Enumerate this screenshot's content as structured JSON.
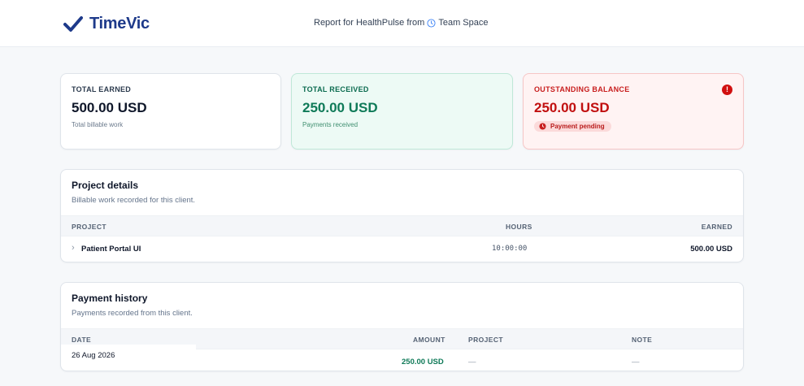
{
  "header": {
    "logo_text": "TimeVic",
    "report_prefix": "Report for HealthPulse from",
    "report_space": "Team Space",
    "brand_color": "#1e3a8a"
  },
  "summary": {
    "earned": {
      "label": "TOTAL EARNED",
      "value": "500.00 USD",
      "sub": "Total billable work"
    },
    "received": {
      "label": "TOTAL RECEIVED",
      "value": "250.00 USD",
      "sub": "Payments received"
    },
    "outstanding": {
      "label": "OUTSTANDING BALANCE",
      "value": "250.00 USD",
      "badge": "Payment pending",
      "alert_icon": "!"
    }
  },
  "projects": {
    "title": "Project details",
    "subtitle": "Billable work recorded for this client.",
    "columns": {
      "project": "PROJECT",
      "hours": "HOURS",
      "earned": "EARNED"
    },
    "rows": [
      {
        "chevron": "›",
        "name": "Patient Portal UI",
        "hours": "10:00:00",
        "earned": "500.00 USD"
      }
    ]
  },
  "payments": {
    "title": "Payment history",
    "subtitle": "Payments recorded from this client.",
    "columns": {
      "date": "DATE",
      "amount": "AMOUNT",
      "project": "PROJECT",
      "note": "NOTE"
    },
    "rows": [
      {
        "date": "26 Aug 2026",
        "amount": "250.00 USD",
        "project": "—",
        "note": "—"
      }
    ]
  }
}
